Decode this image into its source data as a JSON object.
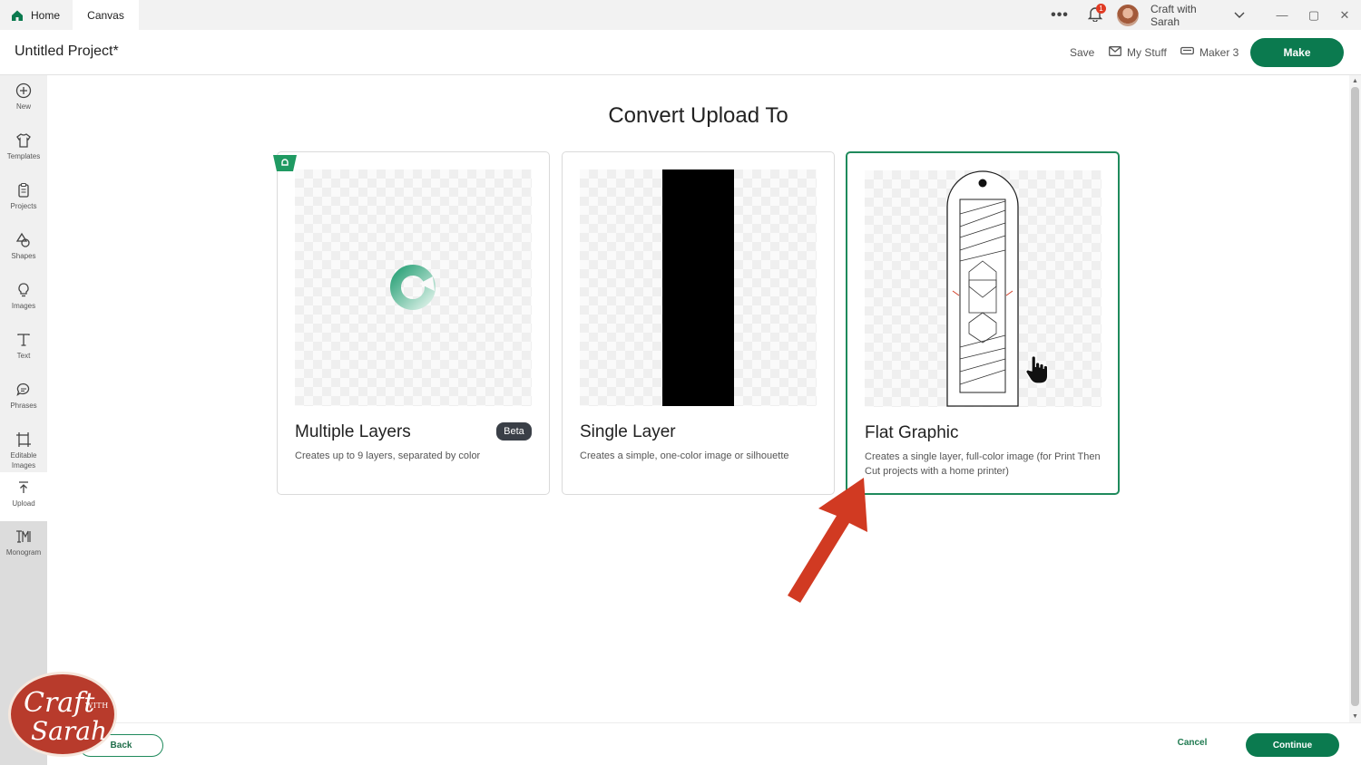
{
  "titlebar": {
    "tabs": [
      {
        "label": "Home",
        "icon": "home-icon"
      },
      {
        "label": "Canvas"
      }
    ],
    "notification_count": "1",
    "user_name": "Craft with Sarah",
    "window_controls": [
      "—",
      "▢",
      "✕"
    ]
  },
  "header": {
    "project_title": "Untitled Project*",
    "save_label": "Save",
    "my_stuff_label": "My Stuff",
    "machine_label": "Maker 3",
    "make_label": "Make"
  },
  "sidebar": {
    "items": [
      {
        "label": "New",
        "icon": "plus-circle-icon"
      },
      {
        "label": "Templates",
        "icon": "tshirt-icon"
      },
      {
        "label": "Projects",
        "icon": "clipboard-icon"
      },
      {
        "label": "Shapes",
        "icon": "shapes-icon"
      },
      {
        "label": "Images",
        "icon": "lightbulb-icon"
      },
      {
        "label": "Text",
        "icon": "text-icon"
      },
      {
        "label": "Phrases",
        "icon": "speech-bubble-icon"
      },
      {
        "label": "Editable Images",
        "icon": "editable-image-icon"
      },
      {
        "label": "Upload",
        "icon": "upload-icon"
      },
      {
        "label": "Monogram",
        "icon": "monogram-icon"
      }
    ]
  },
  "main": {
    "title": "Convert Upload To",
    "cards": [
      {
        "title": "Multiple Layers",
        "badge": "Beta",
        "description": "Creates up to 9 layers, separated by color"
      },
      {
        "title": "Single Layer",
        "description": "Creates a simple, one-color image or silhouette"
      },
      {
        "title": "Flat Graphic",
        "description": "Creates a single layer, full-color image (for Print Then Cut projects with a home printer)",
        "selected": true
      }
    ]
  },
  "footer": {
    "back_label": "Back",
    "cancel_label": "Cancel",
    "continue_label": "Continue"
  },
  "colors": {
    "accent": "#0b7a4f",
    "arrow": "#d13a22",
    "badge": "#3a3f47"
  }
}
